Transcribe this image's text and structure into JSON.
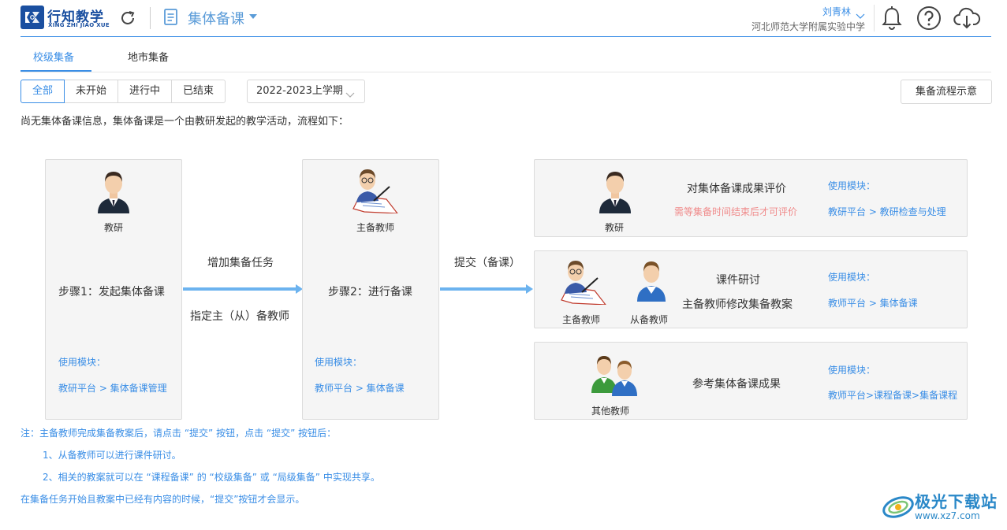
{
  "header": {
    "logo_title": "行知教学",
    "logo_sub": "XING ZHI JIAO XUE",
    "module_title": "集体备课",
    "user_name": "刘青林",
    "school": "河北师范大学附属实验中学",
    "icons": [
      "refresh-icon",
      "document-icon",
      "bell-icon",
      "help-icon",
      "cloud-download-icon"
    ]
  },
  "tabs": [
    {
      "label": "校级集备",
      "active": true
    },
    {
      "label": "地市集备",
      "active": false
    }
  ],
  "filter": {
    "buttons": [
      "全部",
      "未开始",
      "进行中",
      "已结束"
    ],
    "active": "全部",
    "term": "2022-2023上学期",
    "flow_button": "集备流程示意"
  },
  "intro": "尚无集体备课信息，集体备课是一个由教研发起的教学活动，流程如下：",
  "step1": {
    "role": "教研",
    "title": "步骤1：发起集体备课",
    "use_label": "使用模块：",
    "use_path": "教研平台 > 集体备课管理"
  },
  "arrow1": {
    "top": "增加集备任务",
    "bottom": "指定主（从）备教师"
  },
  "step2": {
    "role": "主备教师",
    "title": "步骤2：进行备课",
    "use_label": "使用模块：",
    "use_path": "教师平台 > 集体备课"
  },
  "arrow2": {
    "top": "提交（备课）"
  },
  "right1": {
    "role": "教研",
    "title": "对集体备课成果评价",
    "warn": "需等集备时间结束后才可评价",
    "use_label": "使用模块：",
    "use_path": "教研平台 > 教研检查与处理"
  },
  "right2": {
    "role_main": "主备教师",
    "role_sub": "从备教师",
    "title1": "课件研讨",
    "title2": "主备教师修改集备教案",
    "use_label": "使用模块：",
    "use_path": "教师平台 > 集体备课"
  },
  "right3": {
    "role": "其他教师",
    "title": "参考集体备课成果",
    "use_label": "使用模块：",
    "use_path": "教师平台>课程备课>集备课程"
  },
  "notes": {
    "n0": "注：主备教师完成集备教案后，请点击 “提交” 按钮，点击 “提交” 按钮后：",
    "n1": "1、从备教师可以进行课件研讨。",
    "n2": "2、相关的教案就可以在 “课程备课” 的 “校级集备” 或 “局级集备” 中实现共享。",
    "n3": "在集备任务开始且教案中已经有内容的时候，“提交”按钮才会显示。"
  },
  "watermark": {
    "title": "极光下载站",
    "url": "www.xz7.com"
  },
  "colors": {
    "accent": "#3a8ee6",
    "brand": "#1a4fa0",
    "warn": "#f08a8a",
    "arrow": "#6cb3ef"
  }
}
